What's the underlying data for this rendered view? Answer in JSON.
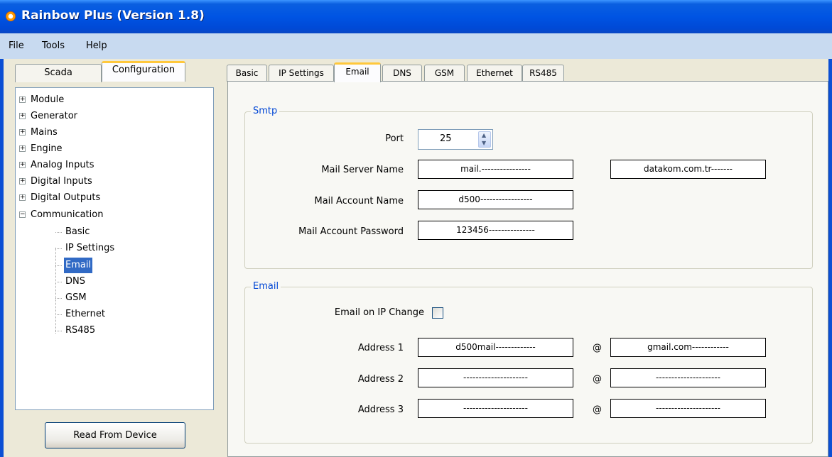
{
  "window": {
    "title": "Rainbow Plus (Version 1.8)"
  },
  "menu": {
    "file": "File",
    "tools": "Tools",
    "help": "Help"
  },
  "left_tabs": {
    "scada": "Scada",
    "configuration": "Configuration"
  },
  "tree": {
    "module": "Module",
    "generator": "Generator",
    "mains": "Mains",
    "engine": "Engine",
    "analog_inputs": "Analog Inputs",
    "digital_inputs": "Digital Inputs",
    "digital_outputs": "Digital Outputs",
    "communication": "Communication",
    "children": {
      "basic": "Basic",
      "ip_settings": "IP Settings",
      "email": "Email",
      "dns": "DNS",
      "gsm": "GSM",
      "ethernet": "Ethernet",
      "rs485": "RS485"
    },
    "expand_glyph": "+",
    "collapse_glyph": "−"
  },
  "read_button": "Read From Device",
  "right_tabs": {
    "basic": "Basic",
    "ip_settings": "IP Settings",
    "email": "Email",
    "dns": "DNS",
    "gsm": "GSM",
    "ethernet": "Ethernet",
    "rs485": "RS485"
  },
  "smtp": {
    "legend": "Smtp",
    "port_label": "Port",
    "port_value": "25",
    "server_label": "Mail Server Name",
    "server_value_1": "mail.----------------",
    "server_value_2": "datakom.com.tr-------",
    "account_label": "Mail Account Name",
    "account_value": "d500-----------------",
    "password_label": "Mail Account Password",
    "password_value": "123456---------------"
  },
  "email": {
    "legend": "Email",
    "ip_change_label": "Email on IP Change",
    "ip_change_checked": false,
    "at_sign": "@",
    "addresses": [
      {
        "label": "Address 1",
        "user": "d500mail-------------",
        "domain": "gmail.com------------"
      },
      {
        "label": "Address 2",
        "user": "---------------------",
        "domain": "---------------------"
      },
      {
        "label": "Address 3",
        "user": "---------------------",
        "domain": "---------------------"
      }
    ]
  },
  "colors": {
    "titlebar": "#0054e3",
    "menubar": "#c8daf0",
    "selection": "#316ac5",
    "group_legend": "#0046d5",
    "active_tab_accent": "#ffc83c"
  }
}
